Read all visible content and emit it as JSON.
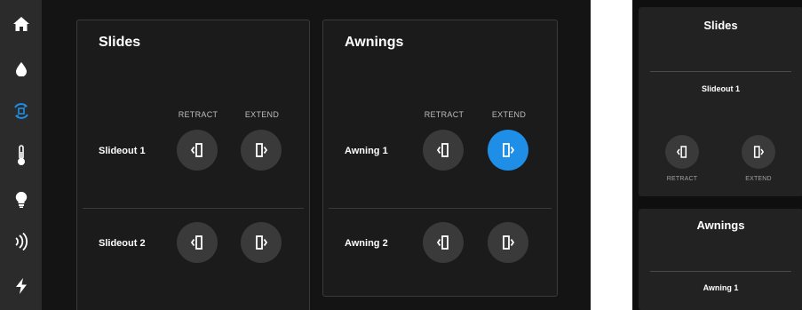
{
  "sidebar": {
    "icons": [
      "home-icon",
      "water-drop-icon",
      "slides-awnings-icon",
      "thermometer-icon",
      "light-bulb-icon",
      "signal-icon",
      "bolt-icon"
    ],
    "active": "slides-awnings-icon",
    "accent": "#1e8ee6"
  },
  "slides": {
    "title": "Slides",
    "retract_label": "RETRACT",
    "extend_label": "EXTEND",
    "rows": [
      {
        "label": "Slideout 1"
      },
      {
        "label": "Slideout 2"
      }
    ]
  },
  "awnings": {
    "title": "Awnings",
    "retract_label": "RETRACT",
    "extend_label": "EXTEND",
    "rows": [
      {
        "label": "Awning 1",
        "active": "extend"
      },
      {
        "label": "Awning 2"
      }
    ]
  },
  "mobile": {
    "slides_title": "Slides",
    "slides_item": "Slideout 1",
    "retract_label": "RETRACT",
    "extend_label": "EXTEND",
    "awnings_title": "Awnings",
    "awnings_item": "Awning 1"
  }
}
